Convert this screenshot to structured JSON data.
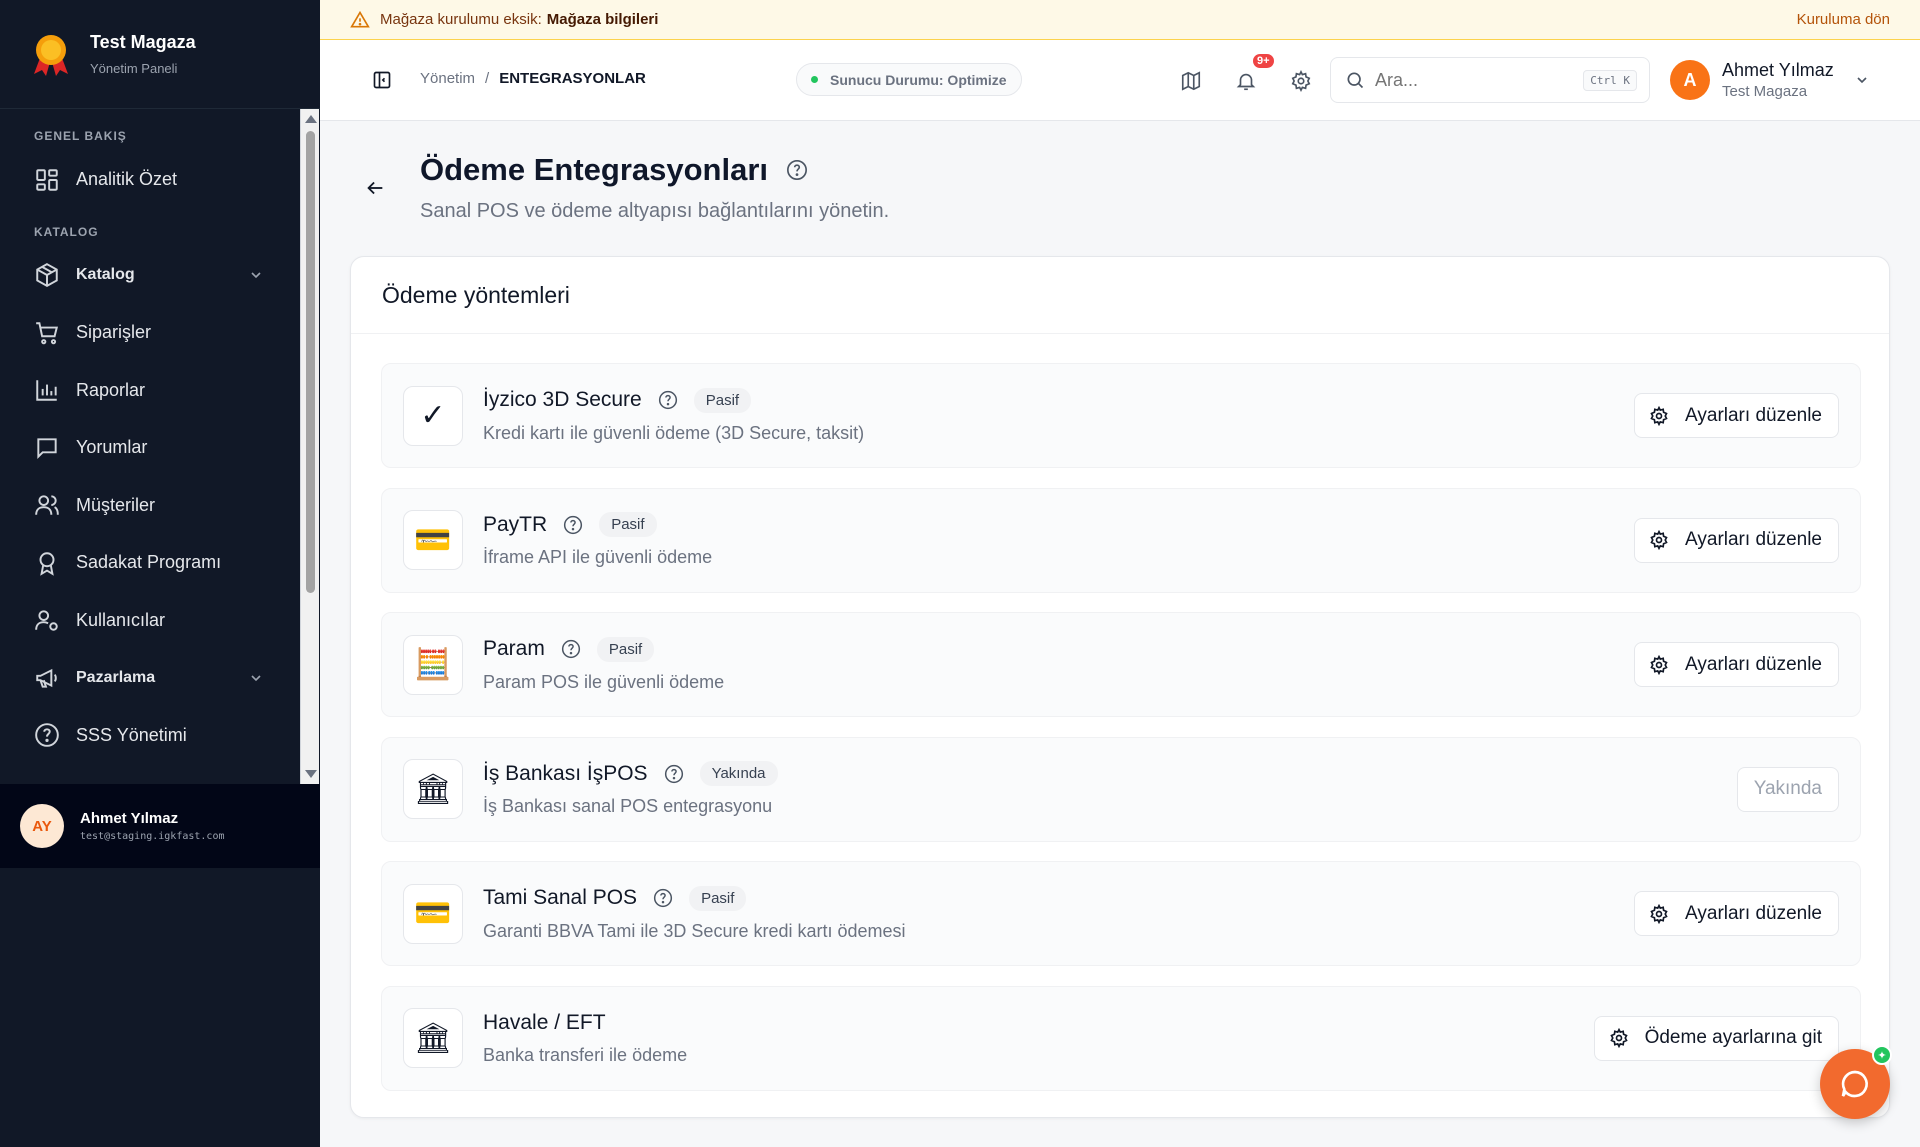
{
  "brand": {
    "title": "Test Magaza",
    "subtitle": "Yönetim Paneli"
  },
  "sidebar": {
    "sections": {
      "overview": "GENEL BAKIŞ",
      "catalog": "KATALOG"
    },
    "items": [
      {
        "label": "Analitik Özet",
        "icon": "dashboard-grid-icon"
      },
      {
        "label": "Katalog",
        "icon": "package-box-icon",
        "expandable": true
      },
      {
        "label": "Siparişler",
        "icon": "shopping-cart-icon"
      },
      {
        "label": "Raporlar",
        "icon": "bar-chart-icon"
      },
      {
        "label": "Yorumlar",
        "icon": "chat-bubble-icon"
      },
      {
        "label": "Müşteriler",
        "icon": "users-icon"
      },
      {
        "label": "Sadakat Programı",
        "icon": "award-icon"
      },
      {
        "label": "Kullanıcılar",
        "icon": "user-settings-icon"
      },
      {
        "label": "Pazarlama",
        "icon": "megaphone-icon",
        "expandable": true
      },
      {
        "label": "SSS Yönetimi",
        "icon": "help-circle-icon"
      }
    ],
    "user": {
      "initials": "AY",
      "name": "Ahmet Yılmaz",
      "email": "test@staging.igkfast.com"
    }
  },
  "banner": {
    "message": "Mağaza kurulumu eksik:",
    "highlight": "Mağaza bilgileri",
    "action": "Kuruluma dön"
  },
  "header": {
    "breadcrumb": {
      "parent": "Yönetim",
      "separator": "/",
      "current": "ENTEGRASYONLAR"
    },
    "server_status": "Sunucu Durumu: Optimize",
    "notification_count": "9+",
    "search": {
      "placeholder": "Ara...",
      "shortcut": "Ctrl K"
    },
    "user": {
      "initial": "A",
      "name": "Ahmet Yılmaz",
      "store": "Test Magaza"
    }
  },
  "page": {
    "title": "Ödeme Entegrasyonları",
    "subtitle": "Sanal POS ve ödeme altyapısı bağlantılarını yönetin."
  },
  "card": {
    "title": "Ödeme yöntemleri",
    "methods": [
      {
        "name": "İyzico 3D Secure",
        "badge": "Pasif",
        "description": "Kredi kartı ile güvenli ödeme (3D Secure, taksit)",
        "logo": "✓",
        "button": "Ayarları düzenle",
        "help": true
      },
      {
        "name": "PayTR",
        "badge": "Pasif",
        "description": "İframe API ile güvenli ödeme",
        "logo": "💳",
        "button": "Ayarları düzenle",
        "help": true
      },
      {
        "name": "Param",
        "badge": "Pasif",
        "description": "Param POS ile güvenli ödeme",
        "logo": "🧮",
        "button": "Ayarları düzenle",
        "help": true
      },
      {
        "name": "İş Bankası İşPOS",
        "badge": "Yakında",
        "description": "İş Bankası sanal POS entegrasyonu",
        "logo": "🏛",
        "button": "Yakında",
        "disabled": true,
        "help": true
      },
      {
        "name": "Tami Sanal POS",
        "badge": "Pasif",
        "description": "Garanti BBVA Tami ile 3D Secure kredi kartı ödemesi",
        "logo": "💳",
        "button": "Ayarları düzenle",
        "help": true
      },
      {
        "name": "Havale / EFT",
        "badge": "",
        "description": "Banka transferi ile ödeme",
        "logo": "🏛",
        "button": "Ödeme ayarlarına git",
        "help": false
      }
    ]
  },
  "colors": {
    "sidebar_bg": "#111827",
    "accent": "#f97316",
    "success": "#22c55e",
    "danger": "#ef4444",
    "banner_bg": "#fef9e7"
  }
}
